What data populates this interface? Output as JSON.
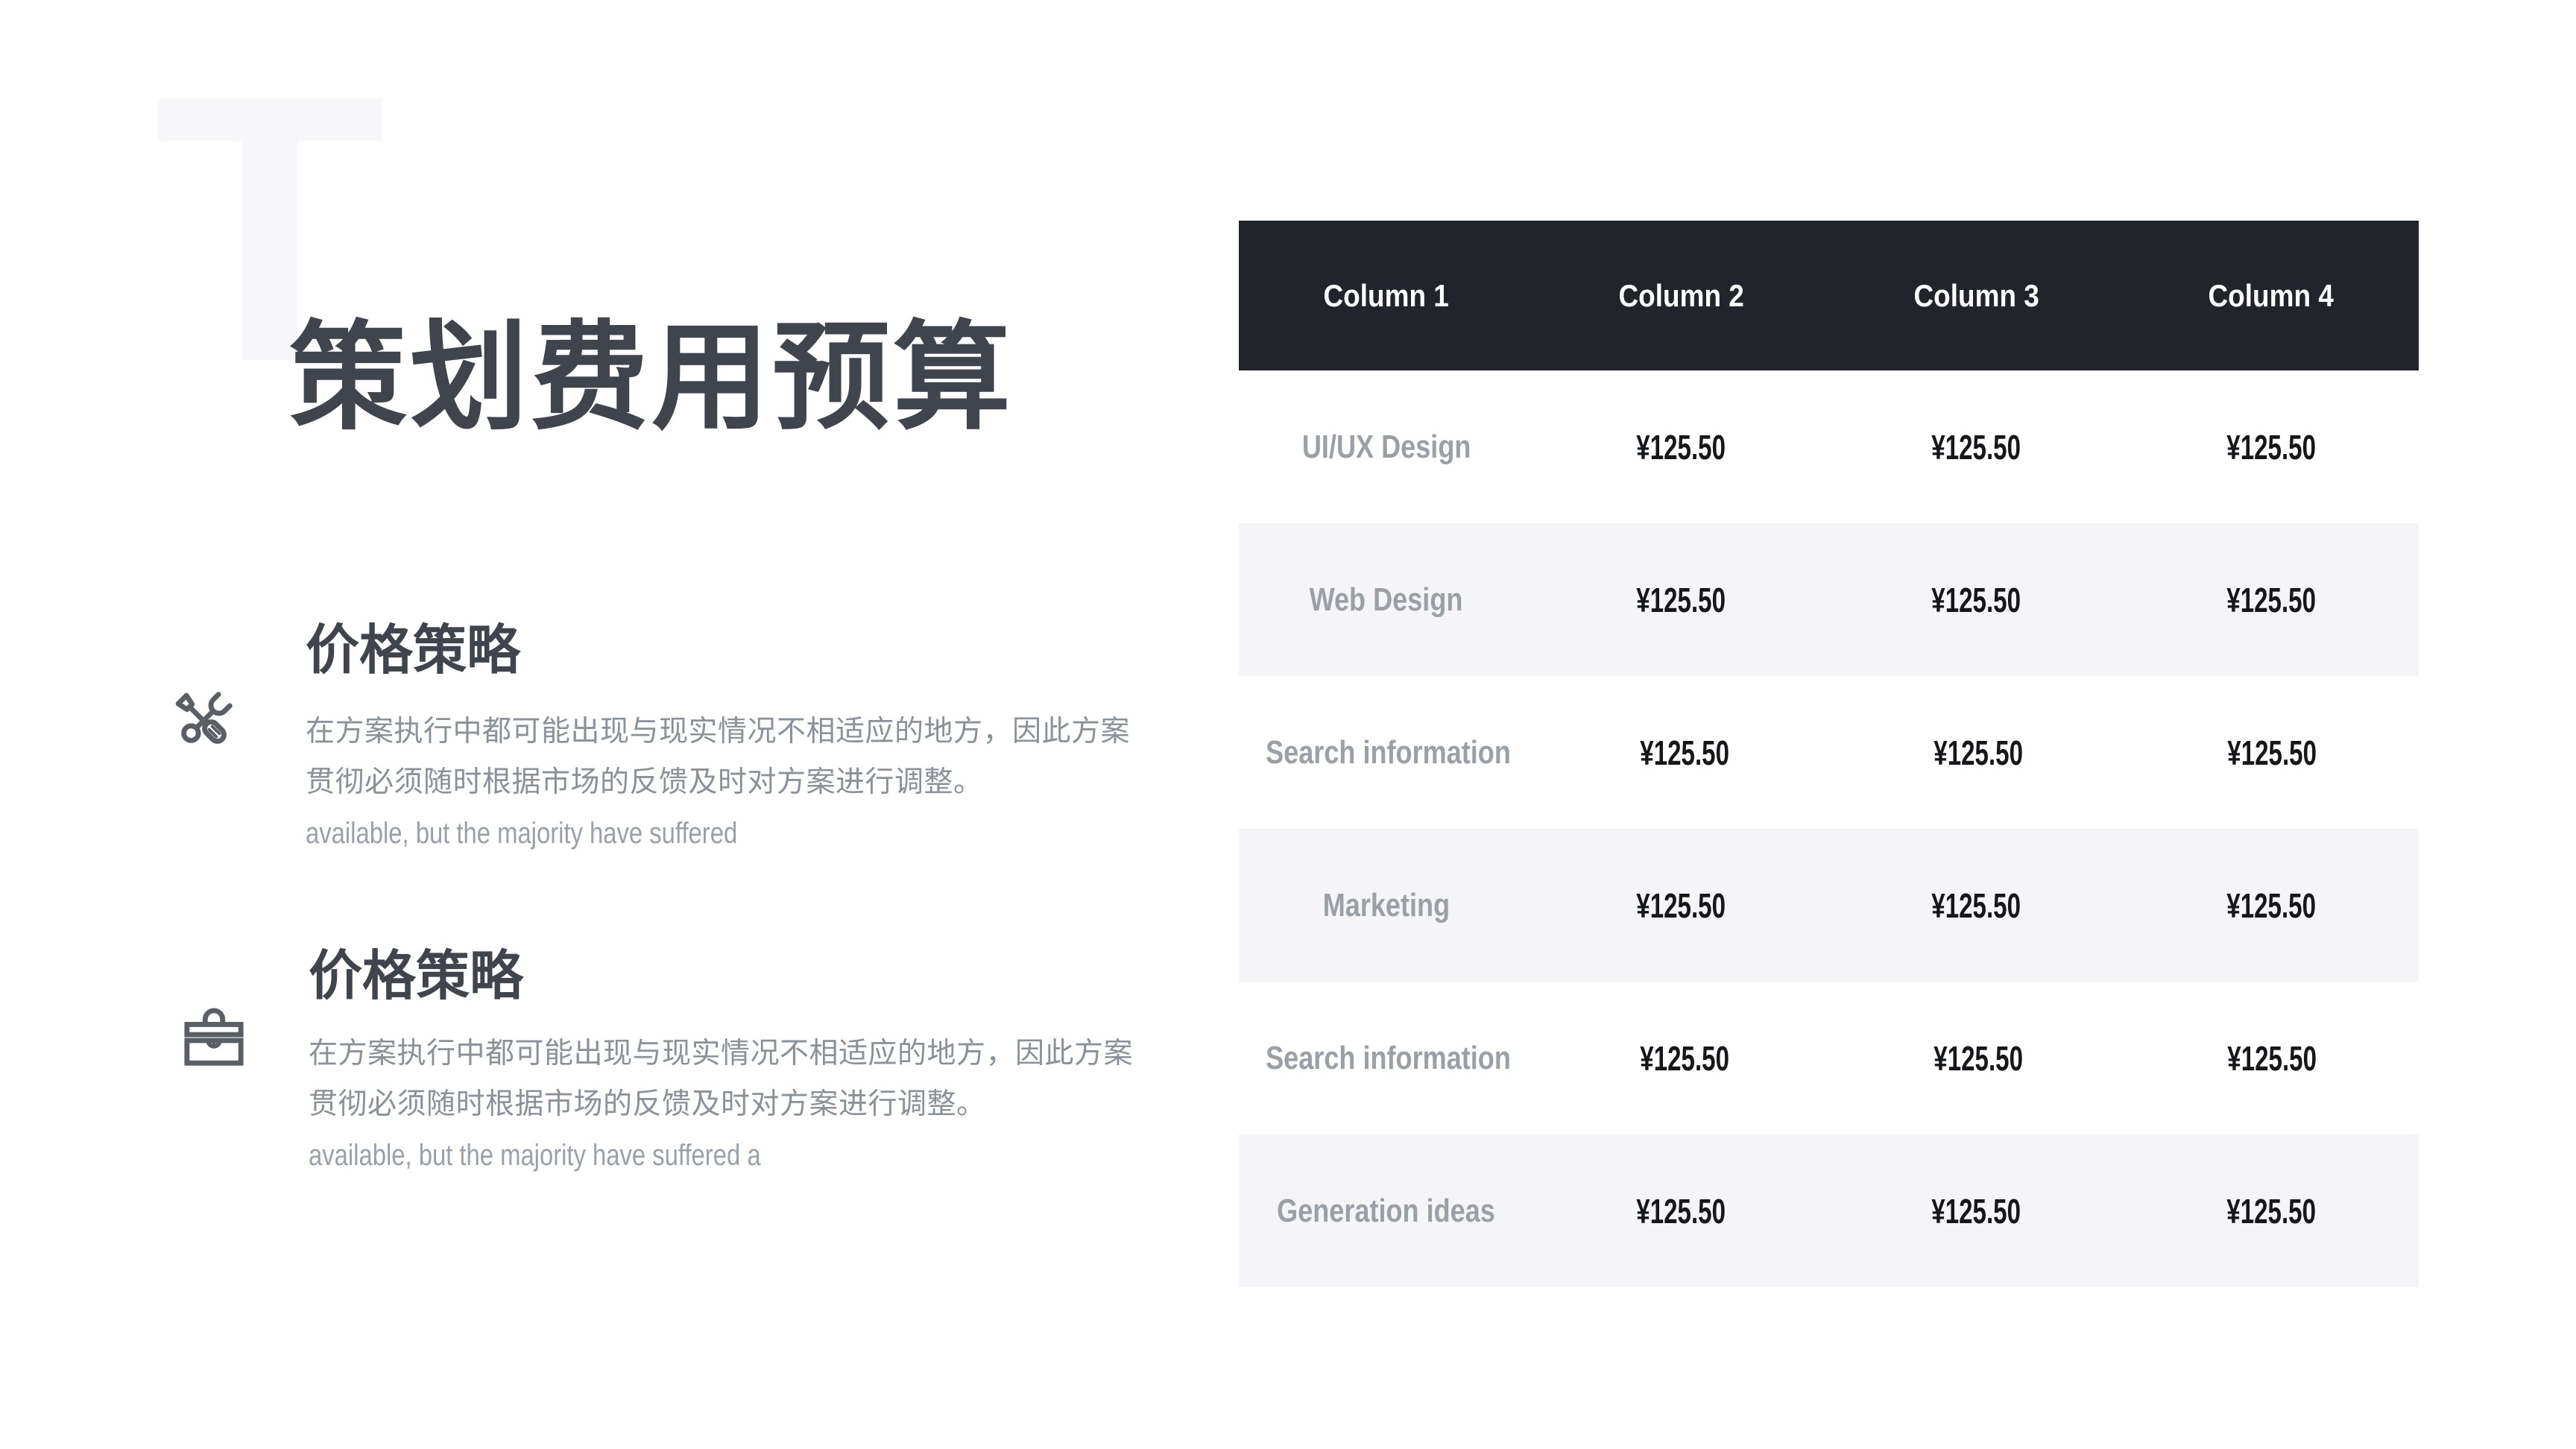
{
  "watermark": "T",
  "title": "策划费用预算",
  "sections": [
    {
      "icon": "tools-icon",
      "heading": "价格策略",
      "body_lines": [
        "在方案执行中都可能出现与现实情况不相适应的地方，因此方案",
        "贯彻必须随时根据市场的反馈及时对方案进行调整。",
        "available, but the majority have suffered"
      ]
    },
    {
      "icon": "briefcase-icon",
      "heading": "价格策略",
      "body_lines": [
        "在方案执行中都可能出现与现实情况不相适应的地方，因此方案",
        "贯彻必须随时根据市场的反馈及时对方案进行调整。",
        "available, but the majority have suffered a"
      ]
    }
  ],
  "table": {
    "headers": [
      "Column 1",
      "Column 2",
      "Column 3",
      "Column 4"
    ],
    "rows": [
      {
        "label": "UI/UX Design",
        "values": [
          "¥125.50",
          "¥125.50",
          "¥125.50"
        ]
      },
      {
        "label": "Web Design",
        "values": [
          "¥125.50",
          "¥125.50",
          "¥125.50"
        ]
      },
      {
        "label": "Search information",
        "values": [
          "¥125.50",
          "¥125.50",
          "¥125.50"
        ]
      },
      {
        "label": "Marketing",
        "values": [
          "¥125.50",
          "¥125.50",
          "¥125.50"
        ]
      },
      {
        "label": "Search information",
        "values": [
          "¥125.50",
          "¥125.50",
          "¥125.50"
        ]
      },
      {
        "label": "Generation ideas",
        "values": [
          "¥125.50",
          "¥125.50",
          "¥125.50"
        ]
      }
    ]
  },
  "colors": {
    "header_bg": "#22242b",
    "header_text": "#ffffff",
    "stripe_bg": "#f5f5f7",
    "title_text": "#3f444d",
    "muted_text": "#9aa0a6",
    "value_text": "#16171a",
    "watermark": "#f7f7f9",
    "icon": "#5a5f66"
  }
}
